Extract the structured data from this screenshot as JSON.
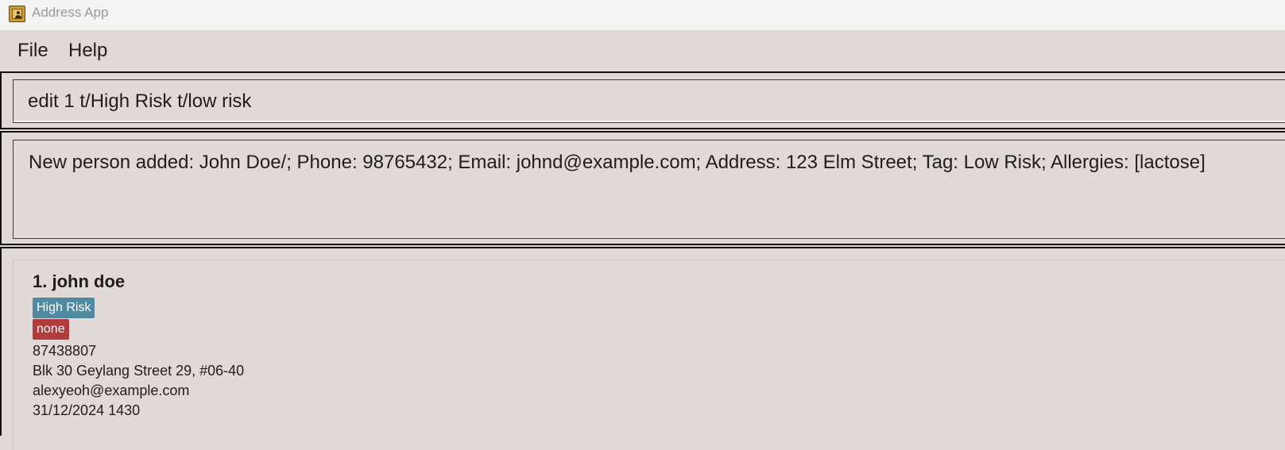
{
  "window": {
    "title": "Address App",
    "icon": "address-book-icon"
  },
  "menu": {
    "items": [
      {
        "label": "File"
      },
      {
        "label": "Help"
      }
    ]
  },
  "command": {
    "value": "edit 1 t/High Risk t/low risk"
  },
  "result": {
    "text": "New person added: John Doe/; Phone: 98765432; Email: johnd@example.com; Address: 123 Elm Street; Tag: Low Risk; Allergies: [lactose]"
  },
  "persons": [
    {
      "name": "1. john doe",
      "tags": [
        {
          "label": "High Risk",
          "color": "#4f8aa1"
        },
        {
          "label": "none",
          "color": "#b23b3b"
        }
      ],
      "phone": "87438807",
      "address": "Blk 30 Geylang Street 29, #06-40",
      "email": "alexyeoh@example.com",
      "appointment": "31/12/2024 1430"
    }
  ]
}
